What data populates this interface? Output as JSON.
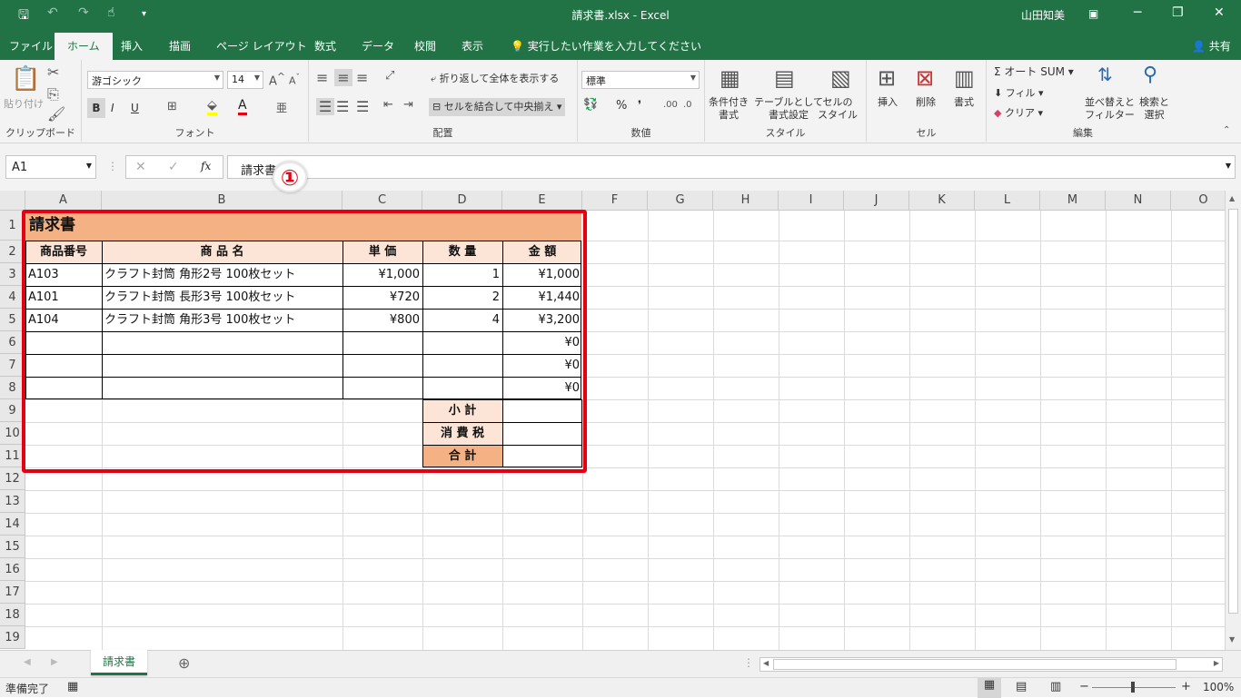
{
  "window": {
    "title": "請求書.xlsx  -  Excel",
    "user": "山田知美"
  },
  "tabs": [
    "ファイル",
    "ホーム",
    "挿入",
    "描画",
    "ページ レイアウト",
    "数式",
    "データ",
    "校閲",
    "表示"
  ],
  "tell_me": "実行したい作業を入力してください",
  "share": "共有",
  "ribbon": {
    "clipboard": {
      "paste": "貼り付け",
      "label": "クリップボード"
    },
    "font": {
      "name": "游ゴシック",
      "size": "14",
      "label": "フォント",
      "bold": "B",
      "italic": "I",
      "underline": "U"
    },
    "alignment": {
      "wrap": "折り返して全体を表示する",
      "merge": "セルを結合して中央揃え",
      "label": "配置"
    },
    "number": {
      "format": "標準",
      "percent": "%",
      "comma": "❜",
      "label": "数値"
    },
    "styles": {
      "conditional": "条件付き\n書式",
      "table": "テーブルとして\n書式設定",
      "cell": "セルの\nスタイル",
      "label": "スタイル"
    },
    "cells": {
      "insert": "挿入",
      "delete": "削除",
      "format": "書式",
      "label": "セル"
    },
    "editing": {
      "autosum": "オート SUM",
      "fill": "フィル",
      "clear": "クリア",
      "sort": "並べ替えと\nフィルター",
      "find": "検索と\n選択",
      "label": "編集"
    }
  },
  "formula_bar": {
    "name_box": "A1",
    "fx": "fx",
    "content": "請求書"
  },
  "callout": "①",
  "columns": [
    "A",
    "B",
    "C",
    "D",
    "E",
    "F",
    "G",
    "H",
    "I",
    "J",
    "K",
    "L",
    "M",
    "N",
    "O"
  ],
  "rows": [
    "1",
    "2",
    "3",
    "4",
    "5",
    "6",
    "7",
    "8",
    "9",
    "10",
    "11",
    "12",
    "13",
    "14",
    "15",
    "16",
    "17",
    "18",
    "19"
  ],
  "sheet": {
    "title": "請求書",
    "headers": [
      "商品番号",
      "商 品 名",
      "単 価",
      "数 量",
      "金 額"
    ],
    "items": [
      [
        "A103",
        "クラフト封筒 角形2号 100枚セット",
        "¥1,000",
        "1",
        "¥1,000"
      ],
      [
        "A101",
        "クラフト封筒 長形3号 100枚セット",
        "¥720",
        "2",
        "¥1,440"
      ],
      [
        "A104",
        "クラフト封筒 角形3号 100枚セット",
        "¥800",
        "4",
        "¥3,200"
      ],
      [
        "",
        "",
        "",
        "",
        "¥0"
      ],
      [
        "",
        "",
        "",
        "",
        "¥0"
      ],
      [
        "",
        "",
        "",
        "",
        "¥0"
      ]
    ],
    "summary": [
      "小 計",
      "消 費 税",
      "合 計"
    ]
  },
  "sheet_tab": "請求書",
  "status": {
    "ready": "準備完了",
    "zoom": "100%"
  },
  "colors": {
    "excel_green": "#217346",
    "title_fill": "#f4b183",
    "header_fill": "#fce4d6",
    "highlight": "#e60012"
  }
}
